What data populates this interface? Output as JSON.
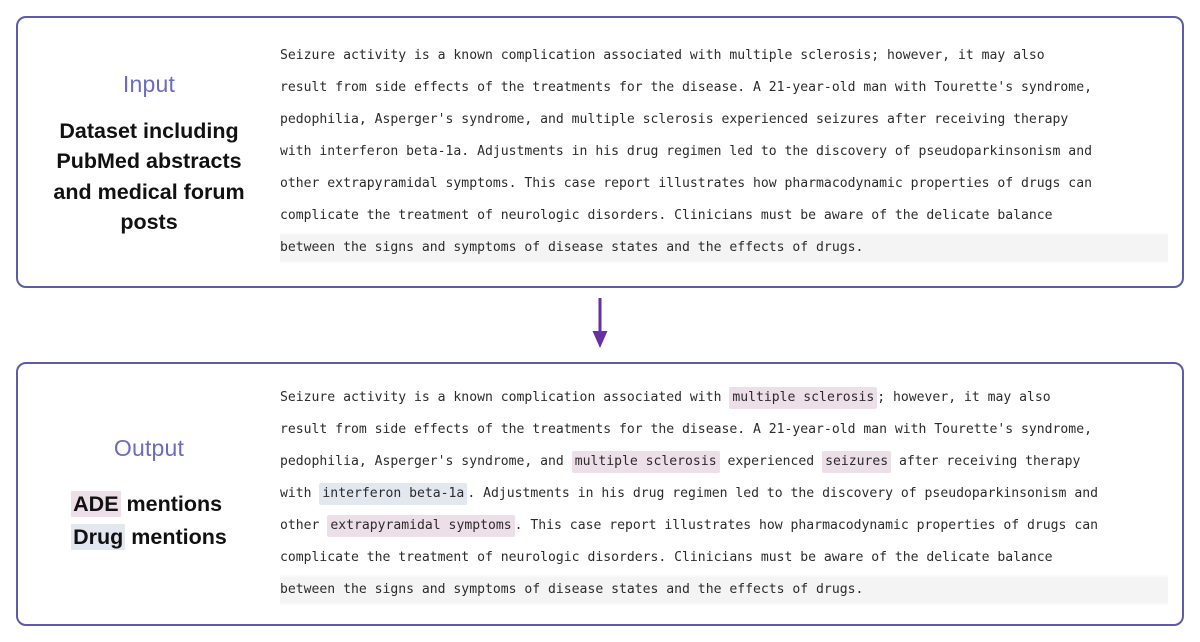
{
  "figure": {
    "accent_border": "#5b5ba8",
    "stage_title_color": "#6b6bc0",
    "arrow_color": "#6a2fa0",
    "ade_highlight": "#ecdfe8",
    "drug_highlight": "#e2e7f0",
    "arrow_icon": "down-arrow"
  },
  "input": {
    "title": "Input",
    "description": "Dataset including PubMed abstracts and medical forum posts",
    "lines": [
      "Seizure activity is a known complication associated with multiple sclerosis; however, it may also",
      "result from side effects of the treatments for the disease. A 21-year-old man with Tourette's syndrome,",
      "pedophilia, Asperger's syndrome, and multiple sclerosis experienced seizures after receiving therapy",
      "with interferon beta-1a. Adjustments in his drug regimen led to the discovery of pseudoparkinsonism and",
      "other extrapyramidal symptoms. This case report illustrates how pharmacodynamic properties of drugs can",
      "complicate the treatment of neurologic disorders. Clinicians must be aware of the delicate balance",
      "between the signs and symptoms of disease states and the effects of drugs."
    ]
  },
  "output": {
    "title": "Output",
    "legend": [
      {
        "chip": "ADE",
        "chip_type": "ade",
        "rest": " mentions"
      },
      {
        "chip": "Drug",
        "chip_type": "drug",
        "rest": " mentions"
      }
    ],
    "lines": [
      {
        "band": false,
        "tokens": [
          {
            "t": "Seizure activity is a known complication associated with ",
            "k": "plain"
          },
          {
            "t": "multiple sclerosis",
            "k": "ade"
          },
          {
            "t": "; however, it may also",
            "k": "plain"
          }
        ]
      },
      {
        "band": false,
        "tokens": [
          {
            "t": "result from side effects of the treatments for the disease. A 21-year-old man with Tourette's syndrome,",
            "k": "plain"
          }
        ]
      },
      {
        "band": false,
        "tokens": [
          {
            "t": "pedophilia, Asperger's syndrome, and ",
            "k": "plain"
          },
          {
            "t": "multiple sclerosis",
            "k": "ade"
          },
          {
            "t": " experienced ",
            "k": "plain"
          },
          {
            "t": "seizures",
            "k": "ade"
          },
          {
            "t": " after receiving therapy",
            "k": "plain"
          }
        ]
      },
      {
        "band": false,
        "tokens": [
          {
            "t": "with ",
            "k": "plain"
          },
          {
            "t": "interferon beta-1a",
            "k": "drug"
          },
          {
            "t": ". Adjustments in his drug regimen led to the discovery of pseudoparkinsonism and",
            "k": "plain"
          }
        ]
      },
      {
        "band": false,
        "tokens": [
          {
            "t": "other ",
            "k": "plain"
          },
          {
            "t": "extrapyramidal symptoms",
            "k": "ade"
          },
          {
            "t": ". This case report illustrates how pharmacodynamic properties of drugs can",
            "k": "plain"
          }
        ]
      },
      {
        "band": false,
        "tokens": [
          {
            "t": "complicate the treatment of neurologic disorders. Clinicians must be aware of the delicate balance",
            "k": "plain"
          }
        ]
      },
      {
        "band": true,
        "tokens": [
          {
            "t": "between the signs and symptoms of disease states and the effects of drugs.",
            "k": "plain"
          }
        ]
      }
    ]
  }
}
